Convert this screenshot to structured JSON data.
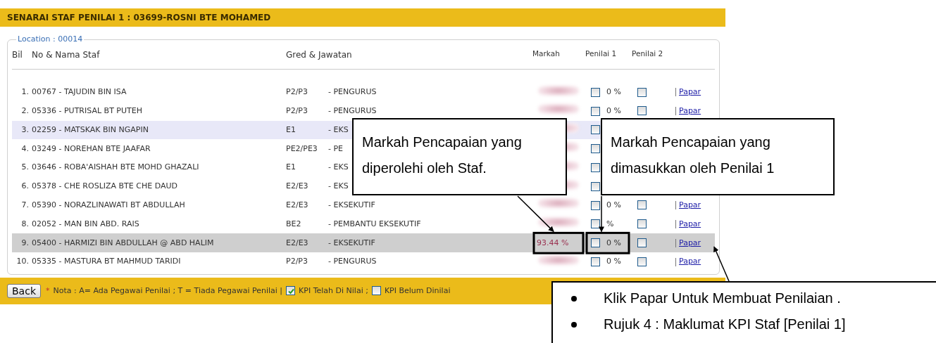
{
  "title": "SENARAI STAF PENILAI 1 : 03699-ROSNI BTE MOHAMED",
  "location": "Location : 00014",
  "columns": {
    "bil": "Bil",
    "name": "No & Nama Staf",
    "gred": "Gred & Jawatan",
    "markah": "Markah",
    "p1": "Penilai 1",
    "p2": "Penilai 2"
  },
  "rows": [
    {
      "bil": "1.",
      "name": "00767 - TAJUDIN BIN ISA",
      "gred": "P2/P3",
      "jawatan": "- PENGURUS",
      "markah_blurred": true,
      "p1_checked": false,
      "pct": "0 %",
      "p2_checked": false,
      "link": "Papar",
      "selected": false,
      "hovered": false
    },
    {
      "bil": "2.",
      "name": "05336 - PUTRISAL BT PUTEH",
      "gred": "P2/P3",
      "jawatan": "- PENGURUS",
      "markah_blurred": true,
      "p1_checked": false,
      "pct": "0 %",
      "p2_checked": false,
      "link": "Papar",
      "selected": false,
      "hovered": false
    },
    {
      "bil": "3.",
      "name": "02259 - MATSKAK BIN NGAPIN",
      "gred": "E1",
      "jawatan": "- EKS",
      "markah_blurred": true,
      "p1_checked": false,
      "selected": false,
      "hovered": true
    },
    {
      "bil": "4.",
      "name": "03249 - NOREHAN BTE JAAFAR",
      "gred": "PE2/PE3",
      "jawatan": "- PE",
      "markah_blurred": true,
      "p1_checked": false,
      "selected": false,
      "hovered": false
    },
    {
      "bil": "5.",
      "name": "03646 - ROBA'AISHAH BTE MOHD GHAZALI",
      "gred": "E1",
      "jawatan": "- EKS",
      "markah_blurred": true,
      "p1_checked": false,
      "selected": false,
      "hovered": false
    },
    {
      "bil": "6.",
      "name": "05378 - CHE ROSLIZA BTE CHE DAUD",
      "gred": "E2/E3",
      "jawatan": "- EKS",
      "markah_blurred": true,
      "p1_checked": false,
      "selected": false,
      "hovered": false
    },
    {
      "bil": "7.",
      "name": "05390 - NORAZLINAWATI BT ABDULLAH",
      "gred": "E2/E3",
      "jawatan": "- EKSEKUTIF",
      "markah_blurred": true,
      "p1_checked": false,
      "pct": "0 %",
      "p2_checked": false,
      "link": "Papar",
      "selected": false,
      "hovered": false
    },
    {
      "bil": "8.",
      "name": "02052 - MAN BIN ABD. RAIS",
      "gred": "BE2",
      "jawatan": "- PEMBANTU EKSEKUTIF",
      "markah_blurred": true,
      "p1_checked": false,
      "pct": "%",
      "p2_checked": false,
      "link": "Papar",
      "selected": false,
      "hovered": false
    },
    {
      "bil": "9.",
      "name": "05400 - HARMIZI BIN ABDULLAH @ ABD HALIM",
      "gred": "E2/E3",
      "jawatan": "- EKSEKUTIF",
      "markah": "93.44 %",
      "p1_checked": false,
      "pct": "0 %",
      "p2_checked": false,
      "link": "Papar",
      "selected": true,
      "hovered": false
    },
    {
      "bil": "10.",
      "name": "05335 - MASTURA BT MAHMUD TARIDI",
      "gred": "P2/P3",
      "jawatan": "- PENGURUS",
      "markah_blurred": true,
      "p1_checked": false,
      "pct": "0 %",
      "p2_checked": false,
      "link": "Papar",
      "selected": false,
      "hovered": false
    }
  ],
  "footer": {
    "button": "Back",
    "note_mark": "*",
    "note": "Nota : A= Ada Pegawai Penilai ; T = Tiada Pegawai Penilai |",
    "legend": [
      {
        "checked": true,
        "label": "KPI Telah Di Nilai ;"
      },
      {
        "checked": false,
        "label": "KPI Belum Dinilai"
      }
    ]
  },
  "callouts": [
    {
      "kind": "lines",
      "lines": [
        "Markah Pencapaian yang",
        "diperolehi  oleh  Staf."
      ]
    },
    {
      "kind": "lines",
      "lines": [
        "Markah Pencapaian yang",
        "dimasukkan oleh  Penilai 1"
      ]
    },
    {
      "kind": "bullets",
      "lines": [
        "Klik Papar Untuk Membuat Penilaian .",
        "Rujuk 4 : Maklumat KPI Staf [Penilai 1]"
      ]
    }
  ]
}
